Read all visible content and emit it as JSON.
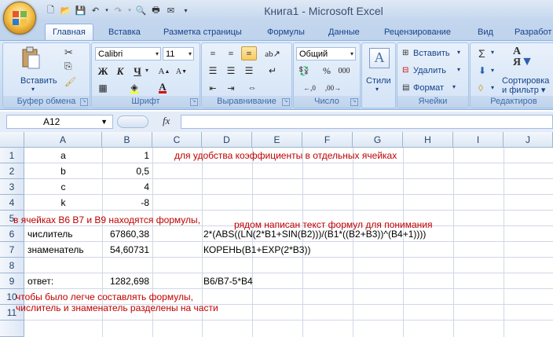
{
  "window": {
    "title": "Книга1 - Microsoft Excel"
  },
  "tabs": [
    "Главная",
    "Вставка",
    "Разметка страницы",
    "Формулы",
    "Данные",
    "Рецензирование",
    "Вид",
    "Разработ"
  ],
  "ribbon": {
    "clipboard": {
      "label": "Буфер обмена",
      "paste": "Вставить"
    },
    "font": {
      "label": "Шрифт",
      "font_name": "Calibri",
      "font_size": "11",
      "bold": "Ж",
      "italic": "К",
      "underline": "Ч"
    },
    "alignment": {
      "label": "Выравнивание"
    },
    "number": {
      "label": "Число",
      "format": "Общий",
      "percent": "%",
      "thousands": "000"
    },
    "styles": {
      "label": "Стили"
    },
    "cells": {
      "label": "Ячейки",
      "insert": "Вставить",
      "delete": "Удалить",
      "format": "Формат"
    },
    "editing": {
      "label": "Редактиров",
      "sort": "Сортировка",
      "filter": "и фильтр"
    }
  },
  "formula_bar": {
    "name_box": "A12",
    "fx": "fx",
    "formula": ""
  },
  "columns": [
    "A",
    "B",
    "C",
    "D",
    "E",
    "F",
    "G",
    "H",
    "I",
    "J"
  ],
  "rows": [
    "1",
    "2",
    "3",
    "4",
    "5",
    "6",
    "7",
    "8",
    "9",
    "10",
    "11"
  ],
  "cells": {
    "A1": "a",
    "B1": "1",
    "A2": "b",
    "B2": "0,5",
    "A3": "c",
    "B3": "4",
    "A4": "k",
    "B4": "-8",
    "A6": "числитель",
    "B6": "67860,38",
    "D6": "2*(ABS((LN(2*B1+SIN(B2)))/(B1*((B2+B3))^(B4+1))))",
    "A7": "знаменатель",
    "B7": "54,60731",
    "D7": "КОРЕНЬ(B1+EXP(2*B3))",
    "A9": "ответ:",
    "B9": "1282,698",
    "D9": "B6/B7-5*B4"
  },
  "notes": {
    "n1": "для удобства коэффициенты в отдельных ячейках",
    "n2": "в ячейках B6 B7 и B9 находятся формулы,",
    "n3": "рядом написан текст формул для понимания",
    "n4": "чтобы было легче составлять формулы,",
    "n5": "числитель и знаменатель разделены на части"
  },
  "colors": {
    "note_red": "#c00000",
    "ribbon_blue": "#15428b"
  }
}
